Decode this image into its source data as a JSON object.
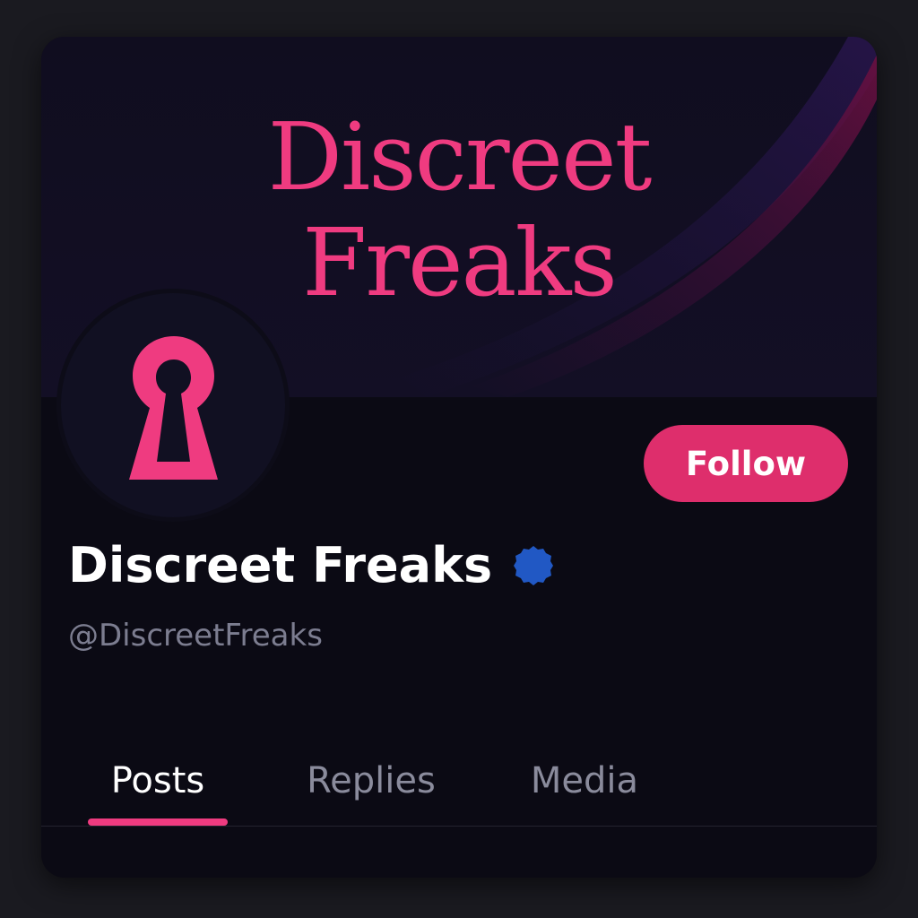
{
  "profile": {
    "banner_title_line1": "Discreet",
    "banner_title_line2": "Freaks",
    "display_name": "Discreet Freaks",
    "handle": "@DiscreetFreaks",
    "verified": true,
    "avatar_icon": "keyhole-icon"
  },
  "actions": {
    "follow_label": "Follow"
  },
  "tabs": [
    {
      "label": "Posts",
      "active": true
    },
    {
      "label": "Replies",
      "active": false
    },
    {
      "label": "Media",
      "active": false
    }
  ],
  "colors": {
    "accent": "#ef3b80",
    "follow_button": "#de2e6c",
    "verified_badge": "#2158c4",
    "background": "#0b0a14"
  }
}
